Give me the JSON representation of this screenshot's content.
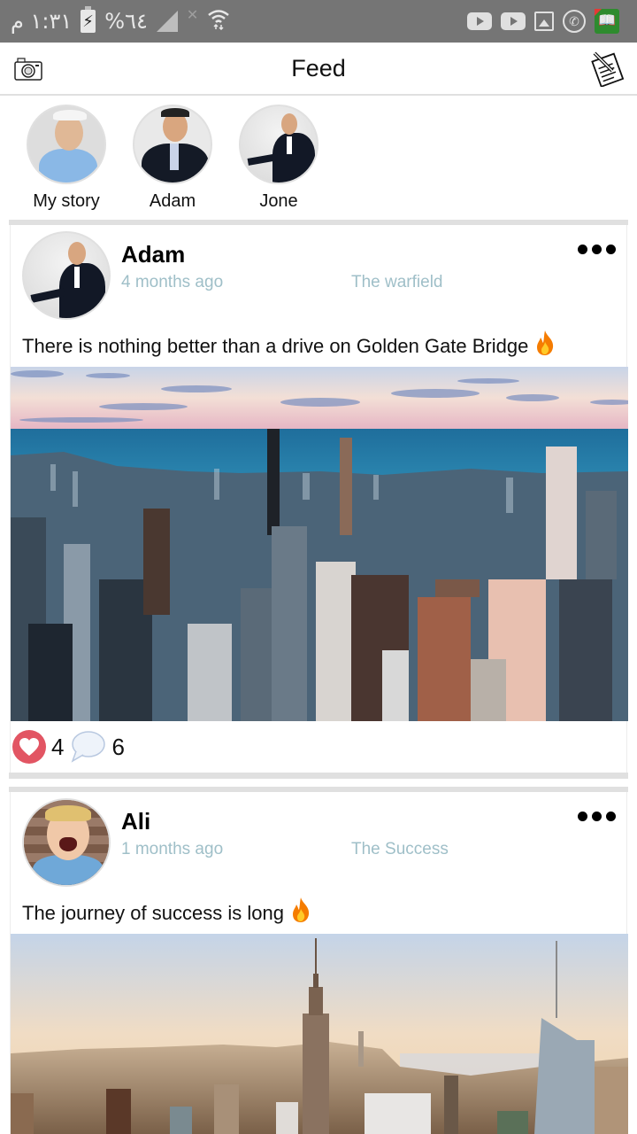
{
  "status_bar": {
    "time": "١:٣١ م",
    "battery_percent": "%٦٤",
    "icons_left": [
      "battery-charging-icon",
      "signal-icon",
      "no-sim-icon",
      "wifi-icon"
    ],
    "notification_icons": [
      "youtube-icon",
      "youtube-icon",
      "gallery-icon",
      "whatsapp-icon",
      "book-app-icon"
    ]
  },
  "app_bar": {
    "title": "Feed",
    "left_icon": "camera-icon",
    "right_icon": "compose-icon"
  },
  "stories": [
    {
      "label": "My story"
    },
    {
      "label": "Adam"
    },
    {
      "label": "Jone"
    }
  ],
  "posts": [
    {
      "author": "Adam",
      "time": "4 months ago",
      "location": "The warfield",
      "text": "There is nothing better than a drive on Golden Gate Bridge",
      "emoji": "fire",
      "likes": "4",
      "comments": "6",
      "image_desc": "Chicago skyline by the lake at sunset"
    },
    {
      "author": "Ali",
      "time": "1 months ago",
      "location": "The Success",
      "text": "The journey of success is long",
      "emoji": "fire",
      "image_desc": "New York skyline with Empire State Building"
    }
  ],
  "colors": {
    "status_bar": "#757575",
    "meta_text": "#9fbfc8",
    "like": "#e25563",
    "separator": "#e0e0e0"
  }
}
